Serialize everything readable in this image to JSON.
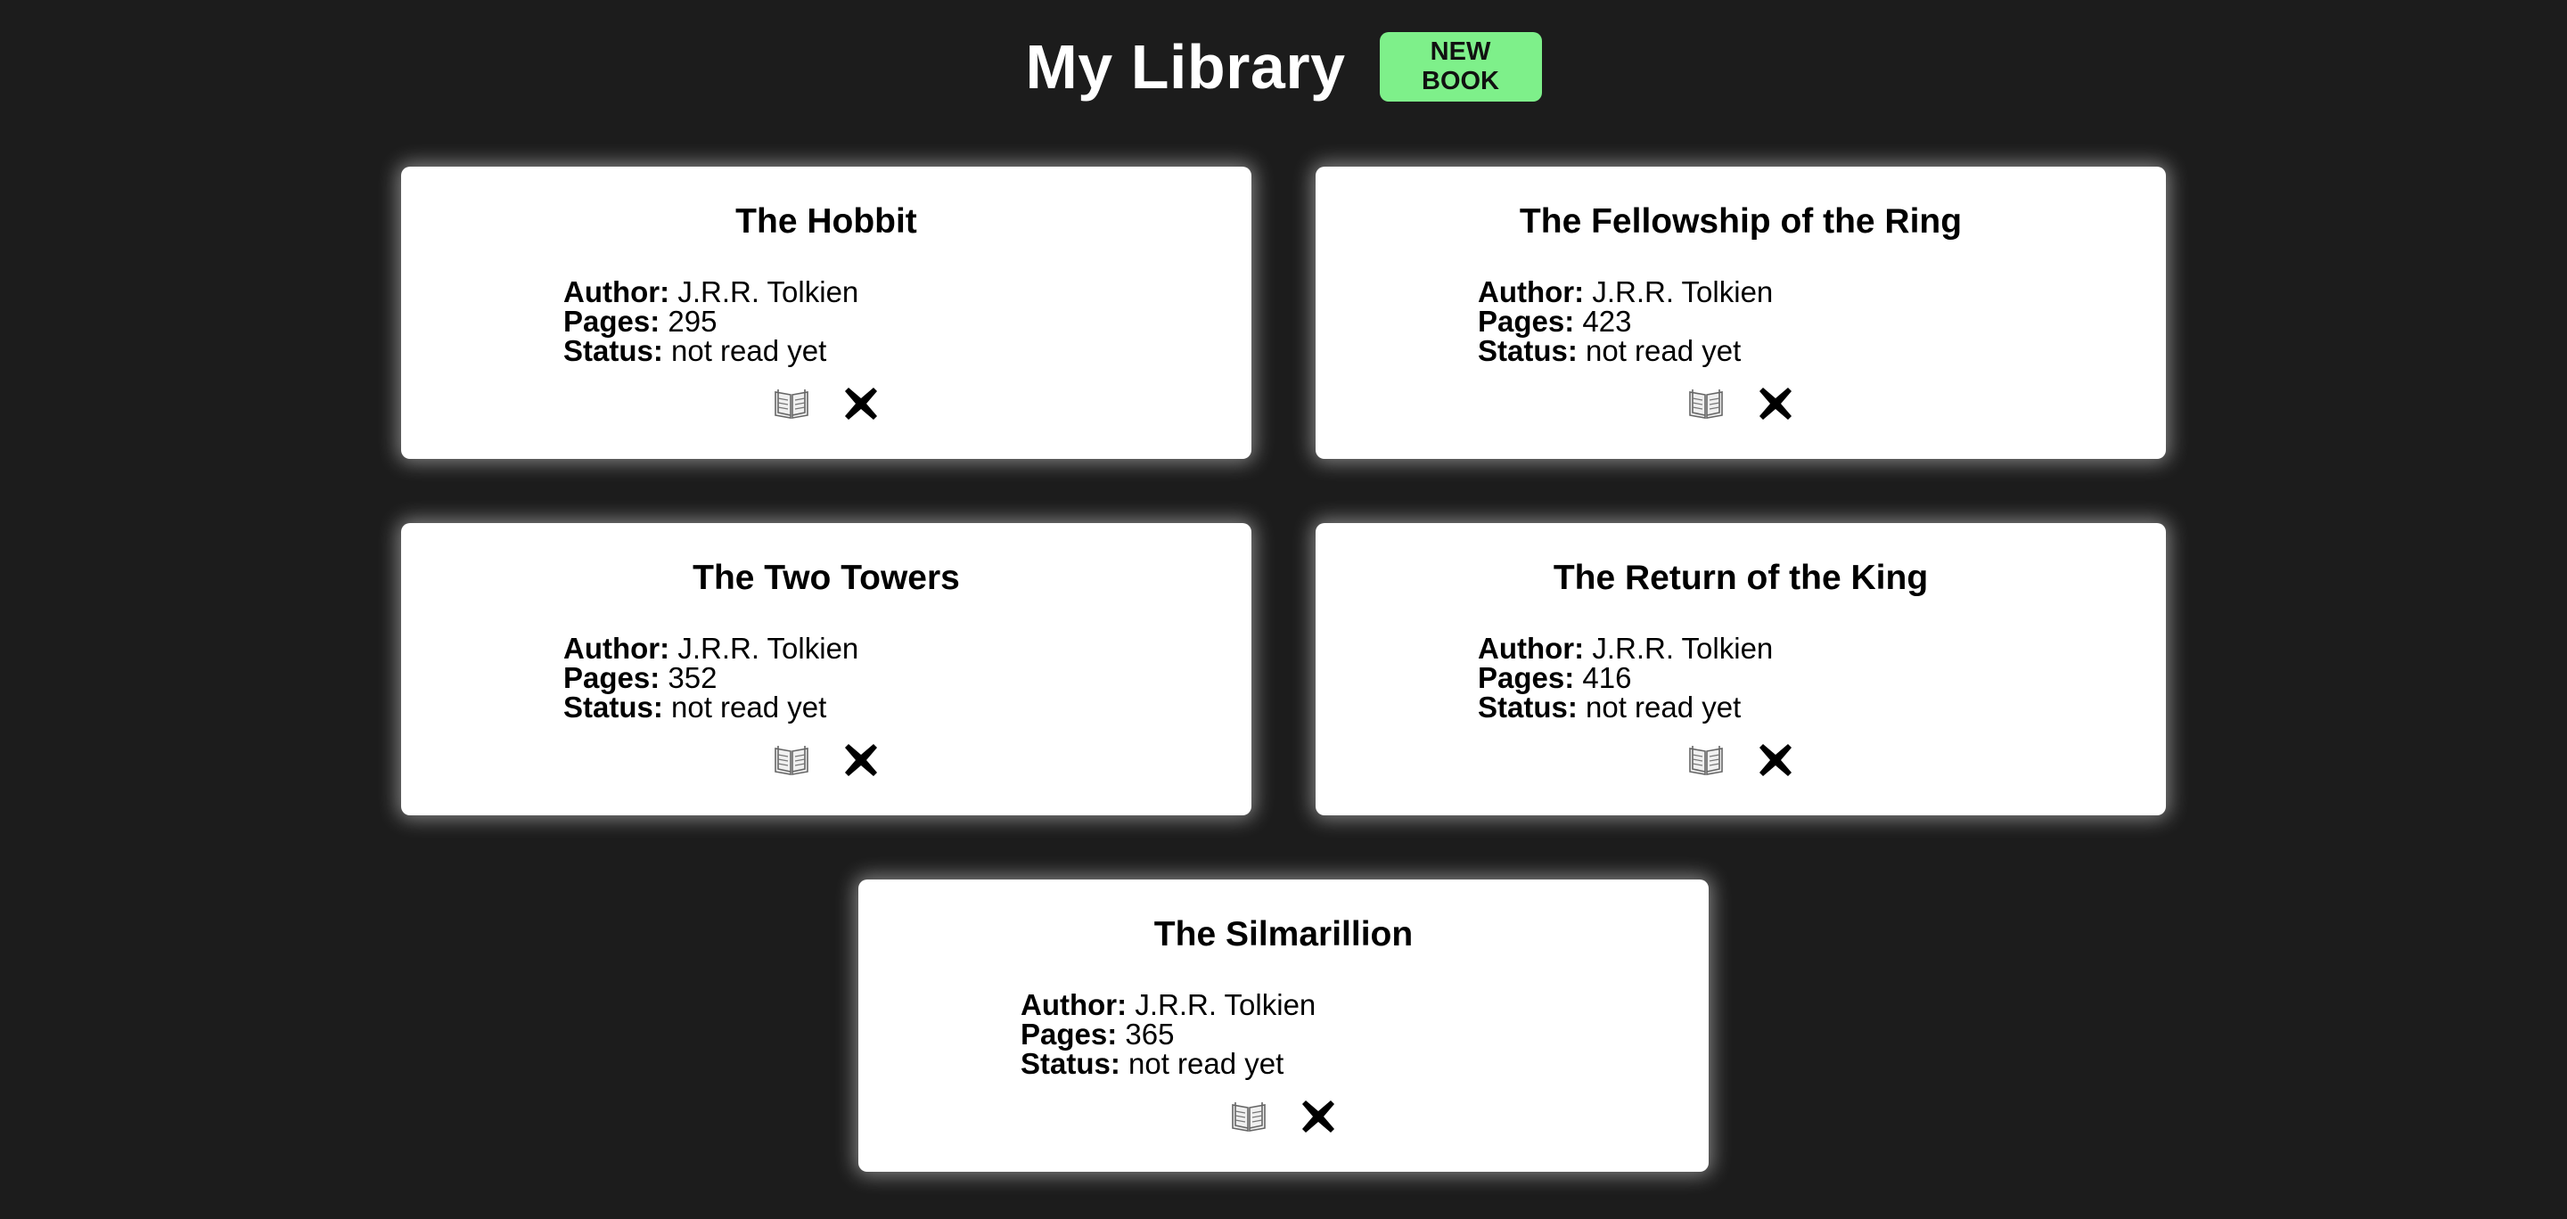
{
  "header": {
    "title": "My Library",
    "new_book_label": "NEW BOOK"
  },
  "colors": {
    "background": "#1c1c1c",
    "accent": "#7ef08a",
    "card": "#ffffff"
  },
  "labels": {
    "author": "Author:",
    "pages": "Pages:",
    "status": "Status:"
  },
  "icons": {
    "read": "open-book-icon",
    "remove": "close-icon"
  },
  "books": [
    {
      "title": "The Hobbit",
      "author": "J.R.R. Tolkien",
      "pages": "295",
      "status": "not read yet"
    },
    {
      "title": "The Fellowship of the Ring",
      "author": "J.R.R. Tolkien",
      "pages": "423",
      "status": "not read yet"
    },
    {
      "title": "The Two Towers",
      "author": "J.R.R. Tolkien",
      "pages": "352",
      "status": "not read yet"
    },
    {
      "title": "The Return of the King",
      "author": "J.R.R. Tolkien",
      "pages": "416",
      "status": "not read yet"
    },
    {
      "title": "The Silmarillion",
      "author": "J.R.R. Tolkien",
      "pages": "365",
      "status": "not read yet"
    }
  ]
}
